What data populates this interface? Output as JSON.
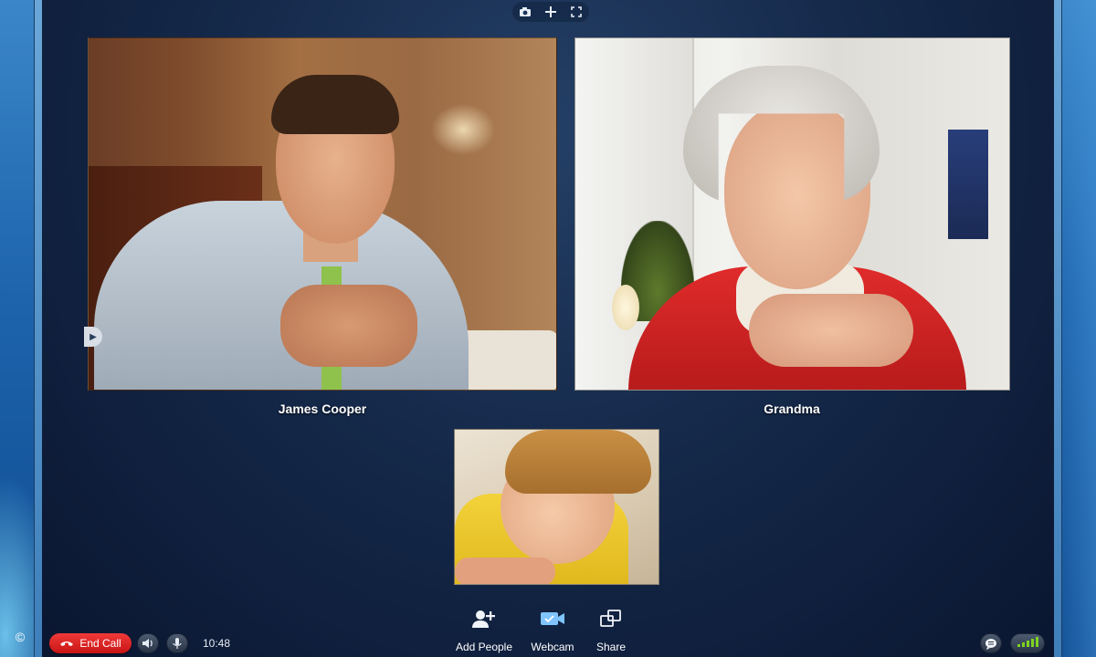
{
  "top_toolbar": {
    "icons": [
      "camera-icon",
      "plus-icon",
      "fullscreen-icon"
    ]
  },
  "participants": [
    {
      "name": "James Cooper"
    },
    {
      "name": "Grandma"
    }
  ],
  "bottom_bar": {
    "end_call_label": "End Call",
    "timer": "10:48",
    "actions": [
      {
        "label": "Add People",
        "icon": "add-person-icon"
      },
      {
        "label": "Webcam",
        "icon": "webcam-icon"
      },
      {
        "label": "Share",
        "icon": "share-icon"
      }
    ]
  },
  "colors": {
    "end_call": "#e02020",
    "webcam_active": "#5cb4ff",
    "signal": "#7ed321"
  }
}
